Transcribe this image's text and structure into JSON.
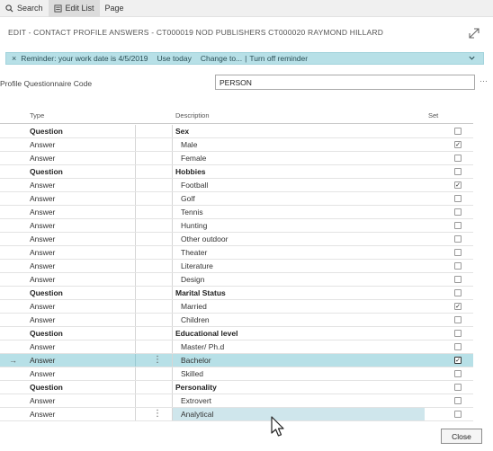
{
  "toolbar": {
    "search_label": "Search",
    "edit_list_label": "Edit List",
    "page_label": "Page"
  },
  "page_title": "EDIT - CONTACT PROFILE ANSWERS - CT000019 NOD PUBLISHERS CT000020 RAYMOND HILLARD",
  "reminder": {
    "close_glyph": "×",
    "text": "Reminder: your work date is 4/5/2019",
    "use_today": "Use today",
    "change_to": "Change to...",
    "separator": "|",
    "turn_off": "Turn off reminder"
  },
  "profile_questionnaire": {
    "label": "Profile Questionnaire Code",
    "value": "PERSON",
    "lookup": "···"
  },
  "columns": {
    "type": "Type",
    "description": "Description",
    "set": "Set"
  },
  "rows": [
    {
      "type": "Question",
      "description": "Sex",
      "set": false,
      "question": true
    },
    {
      "type": "Answer",
      "description": "Male",
      "set": true
    },
    {
      "type": "Answer",
      "description": "Female",
      "set": false
    },
    {
      "type": "Question",
      "description": "Hobbies",
      "set": false,
      "question": true
    },
    {
      "type": "Answer",
      "description": "Football",
      "set": true
    },
    {
      "type": "Answer",
      "description": "Golf",
      "set": false
    },
    {
      "type": "Answer",
      "description": "Tennis",
      "set": false
    },
    {
      "type": "Answer",
      "description": "Hunting",
      "set": false
    },
    {
      "type": "Answer",
      "description": "Other outdoor",
      "set": false
    },
    {
      "type": "Answer",
      "description": "Theater",
      "set": false
    },
    {
      "type": "Answer",
      "description": "Literature",
      "set": false
    },
    {
      "type": "Answer",
      "description": "Design",
      "set": false
    },
    {
      "type": "Question",
      "description": "Marital Status",
      "set": false,
      "question": true
    },
    {
      "type": "Answer",
      "description": "Married",
      "set": true
    },
    {
      "type": "Answer",
      "description": "Children",
      "set": false
    },
    {
      "type": "Question",
      "description": "Educational level",
      "set": false,
      "question": true
    },
    {
      "type": "Answer",
      "description": "Master/ Ph.d",
      "set": false
    },
    {
      "type": "Answer",
      "description": "Bachelor",
      "set": true,
      "selected": true
    },
    {
      "type": "Answer",
      "description": "Skilled",
      "set": false
    },
    {
      "type": "Question",
      "description": "Personality",
      "set": false,
      "question": true
    },
    {
      "type": "Answer",
      "description": "Extrovert",
      "set": false
    },
    {
      "type": "Answer",
      "description": "Analytical",
      "set": false,
      "focused": true
    }
  ],
  "row_glyphs": {
    "current_row_arrow": "→",
    "row_menu": "⋮",
    "check": "✓"
  },
  "close_label": "Close",
  "colors": {
    "accent_row": "#b7e0e7",
    "toolbar_bg": "#f0f0f0"
  }
}
